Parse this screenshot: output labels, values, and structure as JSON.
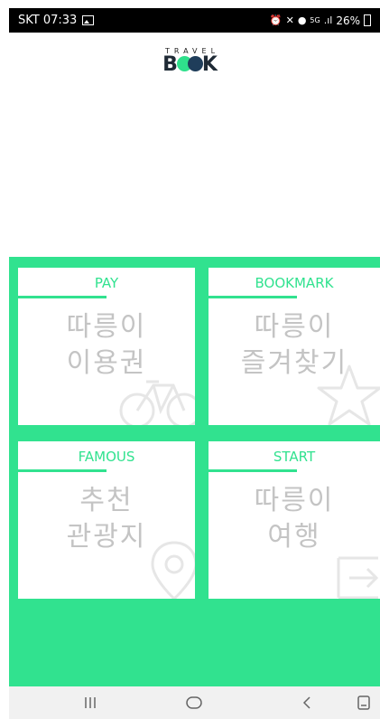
{
  "status": {
    "carrier_time": "SKT 07:33",
    "network_5g": "5G",
    "battery": "26%"
  },
  "logo": {
    "small": "TRAVEL",
    "main_b": "B",
    "main_k": "K"
  },
  "cards": [
    {
      "title": "PAY",
      "line1": "따릉이",
      "line2": "이용권",
      "icon": "bicycle-icon"
    },
    {
      "title": "BOOKMARK",
      "line1": "따릉이",
      "line2": "즐겨찾기",
      "icon": "star-icon"
    },
    {
      "title": "FAMOUS",
      "line1": "추천",
      "line2": "관광지",
      "icon": "map-pin-icon"
    },
    {
      "title": "START",
      "line1": "따릉이",
      "line2": "여행",
      "icon": "exit-arrow-icon"
    }
  ],
  "navbar": {
    "recents": "recent-apps-icon",
    "home": "home-icon",
    "back": "back-icon",
    "extra": "keyboard-icon"
  },
  "colors": {
    "accent": "#31e28f",
    "card_text": "#c4c4c4",
    "status_bg": "#000000"
  }
}
